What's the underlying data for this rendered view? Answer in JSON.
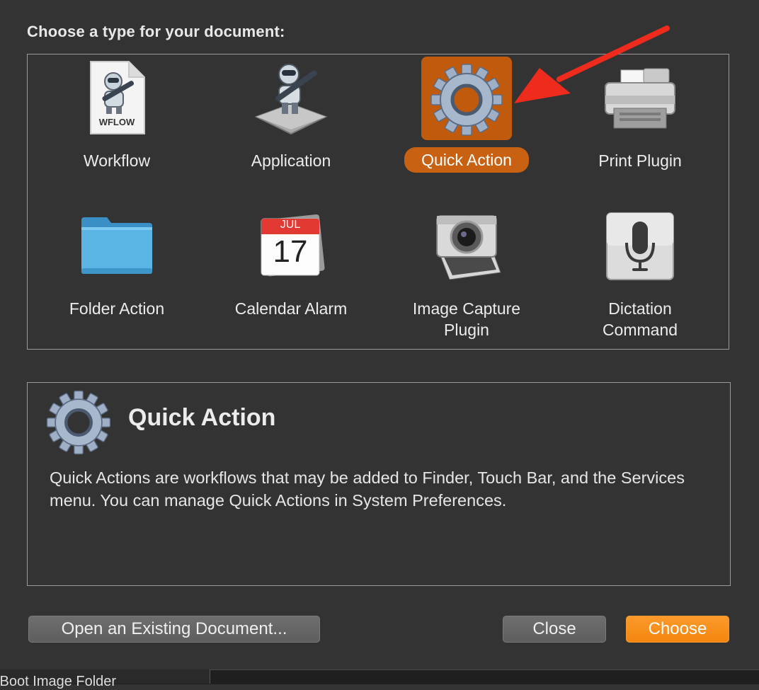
{
  "dialog": {
    "heading": "Choose a type for your document:"
  },
  "types": [
    {
      "label": "Workflow",
      "icon": "workflow-document-icon"
    },
    {
      "label": "Application",
      "icon": "automator-robot-icon"
    },
    {
      "label": "Quick Action",
      "icon": "gear-icon",
      "selected": true
    },
    {
      "label": "Print Plugin",
      "icon": "printer-icon"
    },
    {
      "label": "Folder Action",
      "icon": "folder-icon"
    },
    {
      "label": "Calendar Alarm",
      "icon": "calendar-icon"
    },
    {
      "label_line1": "Image Capture",
      "label_line2": "Plugin",
      "icon": "camera-icon"
    },
    {
      "label_line1": "Dictation",
      "label_line2": "Command",
      "icon": "microphone-icon"
    }
  ],
  "workflow_badge": "WFLOW",
  "calendar": {
    "month": "JUL",
    "day": "17"
  },
  "description": {
    "title": "Quick Action",
    "text": "Quick Actions are workflows that may be added to Finder, Touch Bar, and the Services menu. You can manage Quick Actions in System Preferences."
  },
  "buttons": {
    "open_existing": "Open an Existing Document...",
    "close": "Close",
    "choose": "Choose"
  },
  "background_window_text": "tBoot Image Folder",
  "colors": {
    "selection": "#c05a0c",
    "accent_button": "#f68a13",
    "annotation_arrow": "#ee2b1c"
  }
}
